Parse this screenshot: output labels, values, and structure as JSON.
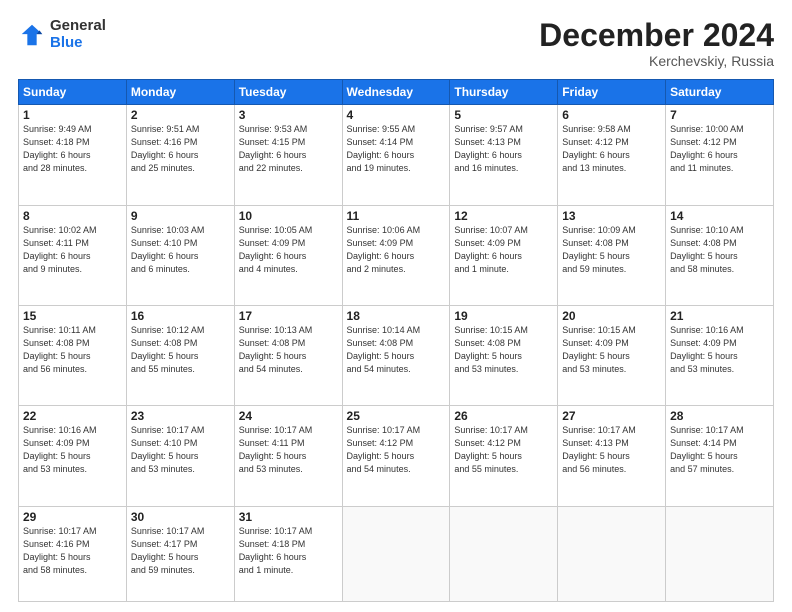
{
  "logo": {
    "general": "General",
    "blue": "Blue"
  },
  "title": "December 2024",
  "location": "Kerchevskiy, Russia",
  "weekdays": [
    "Sunday",
    "Monday",
    "Tuesday",
    "Wednesday",
    "Thursday",
    "Friday",
    "Saturday"
  ],
  "weeks": [
    [
      {
        "day": "1",
        "info": "Sunrise: 9:49 AM\nSunset: 4:18 PM\nDaylight: 6 hours\nand 28 minutes."
      },
      {
        "day": "2",
        "info": "Sunrise: 9:51 AM\nSunset: 4:16 PM\nDaylight: 6 hours\nand 25 minutes."
      },
      {
        "day": "3",
        "info": "Sunrise: 9:53 AM\nSunset: 4:15 PM\nDaylight: 6 hours\nand 22 minutes."
      },
      {
        "day": "4",
        "info": "Sunrise: 9:55 AM\nSunset: 4:14 PM\nDaylight: 6 hours\nand 19 minutes."
      },
      {
        "day": "5",
        "info": "Sunrise: 9:57 AM\nSunset: 4:13 PM\nDaylight: 6 hours\nand 16 minutes."
      },
      {
        "day": "6",
        "info": "Sunrise: 9:58 AM\nSunset: 4:12 PM\nDaylight: 6 hours\nand 13 minutes."
      },
      {
        "day": "7",
        "info": "Sunrise: 10:00 AM\nSunset: 4:12 PM\nDaylight: 6 hours\nand 11 minutes."
      }
    ],
    [
      {
        "day": "8",
        "info": "Sunrise: 10:02 AM\nSunset: 4:11 PM\nDaylight: 6 hours\nand 9 minutes."
      },
      {
        "day": "9",
        "info": "Sunrise: 10:03 AM\nSunset: 4:10 PM\nDaylight: 6 hours\nand 6 minutes."
      },
      {
        "day": "10",
        "info": "Sunrise: 10:05 AM\nSunset: 4:09 PM\nDaylight: 6 hours\nand 4 minutes."
      },
      {
        "day": "11",
        "info": "Sunrise: 10:06 AM\nSunset: 4:09 PM\nDaylight: 6 hours\nand 2 minutes."
      },
      {
        "day": "12",
        "info": "Sunrise: 10:07 AM\nSunset: 4:09 PM\nDaylight: 6 hours\nand 1 minute."
      },
      {
        "day": "13",
        "info": "Sunrise: 10:09 AM\nSunset: 4:08 PM\nDaylight: 5 hours\nand 59 minutes."
      },
      {
        "day": "14",
        "info": "Sunrise: 10:10 AM\nSunset: 4:08 PM\nDaylight: 5 hours\nand 58 minutes."
      }
    ],
    [
      {
        "day": "15",
        "info": "Sunrise: 10:11 AM\nSunset: 4:08 PM\nDaylight: 5 hours\nand 56 minutes."
      },
      {
        "day": "16",
        "info": "Sunrise: 10:12 AM\nSunset: 4:08 PM\nDaylight: 5 hours\nand 55 minutes."
      },
      {
        "day": "17",
        "info": "Sunrise: 10:13 AM\nSunset: 4:08 PM\nDaylight: 5 hours\nand 54 minutes."
      },
      {
        "day": "18",
        "info": "Sunrise: 10:14 AM\nSunset: 4:08 PM\nDaylight: 5 hours\nand 54 minutes."
      },
      {
        "day": "19",
        "info": "Sunrise: 10:15 AM\nSunset: 4:08 PM\nDaylight: 5 hours\nand 53 minutes."
      },
      {
        "day": "20",
        "info": "Sunrise: 10:15 AM\nSunset: 4:09 PM\nDaylight: 5 hours\nand 53 minutes."
      },
      {
        "day": "21",
        "info": "Sunrise: 10:16 AM\nSunset: 4:09 PM\nDaylight: 5 hours\nand 53 minutes."
      }
    ],
    [
      {
        "day": "22",
        "info": "Sunrise: 10:16 AM\nSunset: 4:09 PM\nDaylight: 5 hours\nand 53 minutes."
      },
      {
        "day": "23",
        "info": "Sunrise: 10:17 AM\nSunset: 4:10 PM\nDaylight: 5 hours\nand 53 minutes."
      },
      {
        "day": "24",
        "info": "Sunrise: 10:17 AM\nSunset: 4:11 PM\nDaylight: 5 hours\nand 53 minutes."
      },
      {
        "day": "25",
        "info": "Sunrise: 10:17 AM\nSunset: 4:12 PM\nDaylight: 5 hours\nand 54 minutes."
      },
      {
        "day": "26",
        "info": "Sunrise: 10:17 AM\nSunset: 4:12 PM\nDaylight: 5 hours\nand 55 minutes."
      },
      {
        "day": "27",
        "info": "Sunrise: 10:17 AM\nSunset: 4:13 PM\nDaylight: 5 hours\nand 56 minutes."
      },
      {
        "day": "28",
        "info": "Sunrise: 10:17 AM\nSunset: 4:14 PM\nDaylight: 5 hours\nand 57 minutes."
      }
    ],
    [
      {
        "day": "29",
        "info": "Sunrise: 10:17 AM\nSunset: 4:16 PM\nDaylight: 5 hours\nand 58 minutes."
      },
      {
        "day": "30",
        "info": "Sunrise: 10:17 AM\nSunset: 4:17 PM\nDaylight: 5 hours\nand 59 minutes."
      },
      {
        "day": "31",
        "info": "Sunrise: 10:17 AM\nSunset: 4:18 PM\nDaylight: 6 hours\nand 1 minute."
      },
      null,
      null,
      null,
      null
    ]
  ]
}
